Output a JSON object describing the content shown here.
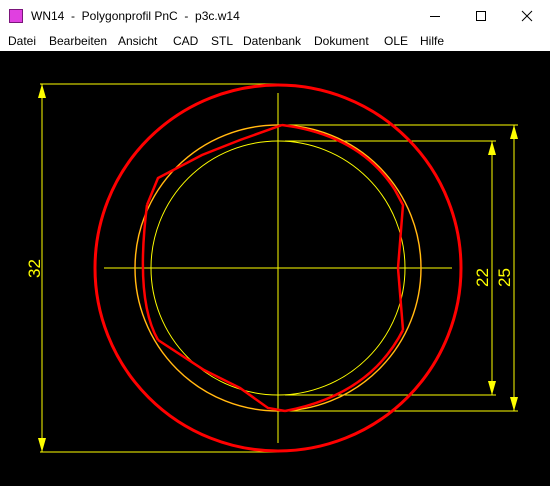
{
  "window": {
    "title": "WN14  -  Polygonprofil PnC  -  p3c.w14",
    "icon": "app-icon",
    "controls": [
      "minimize-icon",
      "maximize-icon",
      "close-icon"
    ]
  },
  "menu": [
    {
      "key": "D",
      "rest": "atei"
    },
    {
      "key": "B",
      "rest": "earbeiten"
    },
    {
      "key": "A",
      "rest": "nsicht"
    },
    {
      "key": "C",
      "rest": "AD"
    },
    {
      "key": "S",
      "rest": "TL"
    },
    {
      "key": "D",
      "rest": "atenbank",
      "pre": "Datenban",
      "post": "k",
      "accent_last": true
    },
    {
      "key": "D",
      "rest": "okument",
      "pre": "Do",
      "post": "kument",
      "accent_mid": "k"
    },
    {
      "key": "O",
      "rest": "LE",
      "pre": "OL",
      "post": "",
      "accent_last_letter": "E"
    },
    {
      "key": "H",
      "rest": "ilfe"
    }
  ],
  "menu_labels": {
    "datei": "Datei",
    "bearbeiten": "Bearbeiten",
    "ansicht": "Ansicht",
    "cad": "CAD",
    "stl": "STL",
    "datenbank": "Datenbank",
    "dokument": "Dokument",
    "ole": "OLE",
    "hilfe": "Hilfe"
  },
  "drawing": {
    "background": "#000000",
    "colors": {
      "outline": "#ff0000",
      "construction": "#ffff00",
      "profile": "#ff6a00"
    },
    "dimensions": {
      "outer": "32",
      "inner": "22",
      "profile": "25"
    }
  }
}
